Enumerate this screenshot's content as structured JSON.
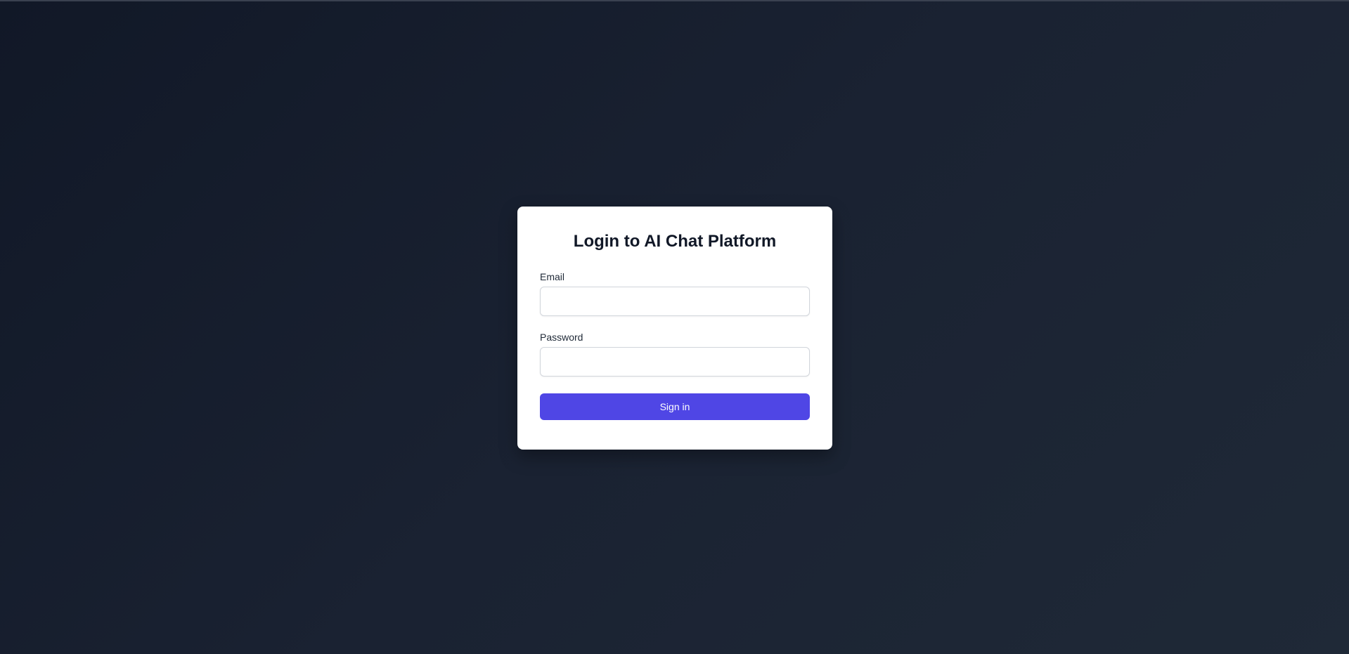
{
  "login": {
    "title": "Login to AI Chat Platform",
    "email_label": "Email",
    "email_value": "",
    "password_label": "Password",
    "password_value": "",
    "signin_label": "Sign in"
  },
  "colors": {
    "background_dark": "#111827",
    "card": "#ffffff",
    "accent": "#4f46e5"
  }
}
